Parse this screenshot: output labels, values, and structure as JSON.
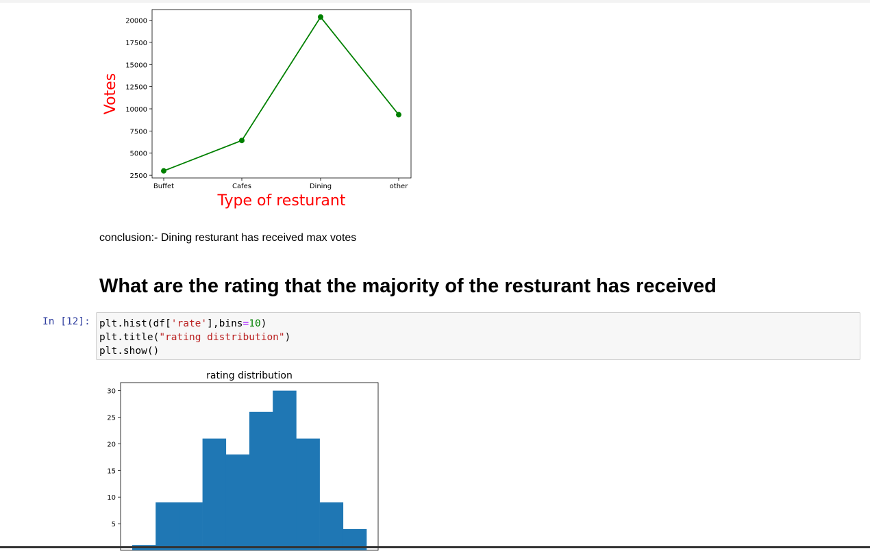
{
  "chart_data": [
    {
      "type": "line",
      "title": "",
      "xlabel": "Type of resturant",
      "ylabel": "Votes",
      "categories": [
        "Buffet",
        "Cafes",
        "Dining",
        "other"
      ],
      "values": [
        3000,
        6430,
        20360,
        9340
      ],
      "ylim": [
        2200,
        21200
      ],
      "yticks": [
        2500,
        5000,
        7500,
        10000,
        12500,
        15000,
        17500,
        20000
      ],
      "color": "#008000",
      "label_color": "#ff0000",
      "grid": false
    },
    {
      "type": "bar",
      "title": "rating distribution",
      "xlabel": "",
      "ylabel": "",
      "bins": [
        {
          "bin": 1,
          "value": 1
        },
        {
          "bin": 2,
          "value": 9
        },
        {
          "bin": 3,
          "value": 9
        },
        {
          "bin": 4,
          "value": 21
        },
        {
          "bin": 5,
          "value": 18
        },
        {
          "bin": 6,
          "value": 26
        },
        {
          "bin": 7,
          "value": 30
        },
        {
          "bin": 8,
          "value": 21
        },
        {
          "bin": 9,
          "value": 9
        },
        {
          "bin": 10,
          "value": 4
        }
      ],
      "ylim": [
        0,
        31.5
      ],
      "yticks": [
        5,
        10,
        15,
        20,
        25,
        30
      ],
      "color": "#1f77b4",
      "grid": false
    }
  ],
  "markdown": {
    "conclusion": "conclusion:- Dining resturant has received max votes",
    "heading": "What are the rating that the majority of the resturant has received"
  },
  "code_cell": {
    "prompt": "In [12]:",
    "lines": [
      [
        {
          "t": "plt.hist(df[",
          "c": ""
        },
        {
          "t": "'rate'",
          "c": "str"
        },
        {
          "t": "],bins",
          "c": ""
        },
        {
          "t": "=",
          "c": "op"
        },
        {
          "t": "10",
          "c": "num"
        },
        {
          "t": ")",
          "c": ""
        }
      ],
      [
        {
          "t": "plt.title(",
          "c": ""
        },
        {
          "t": "\"rating distribution\"",
          "c": "str"
        },
        {
          "t": ")",
          "c": ""
        }
      ],
      [
        {
          "t": "plt.show()",
          "c": ""
        }
      ]
    ]
  }
}
